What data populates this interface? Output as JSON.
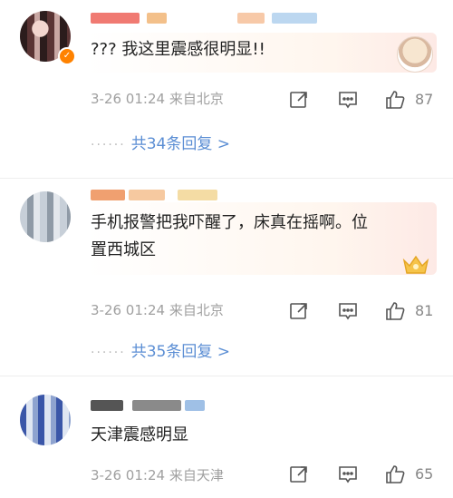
{
  "comments": [
    {
      "text": "??? 我这里震感很明显!!",
      "time": "3-26 01:24",
      "source": "来自北京",
      "likes": "87",
      "replies_label": "共34条回复 >"
    },
    {
      "text": "手机报警把我吓醒了，床真在摇啊。位\n置西城区",
      "time": "3-26 01:24",
      "source": "来自北京",
      "likes": "81",
      "replies_label": "共35条回复 >"
    },
    {
      "text": "天津震感明显",
      "time": "3-26 01:24",
      "source": "来自天津",
      "likes": "65"
    }
  ],
  "icons": {
    "share": "share-icon",
    "comment": "comment-icon",
    "like": "thumb-up-icon",
    "verified": "verified-badge-icon"
  },
  "colors": {
    "reply_link": "#5b8ed4",
    "meta_text": "#a0a0a0",
    "verified_badge": "#ff8200"
  }
}
